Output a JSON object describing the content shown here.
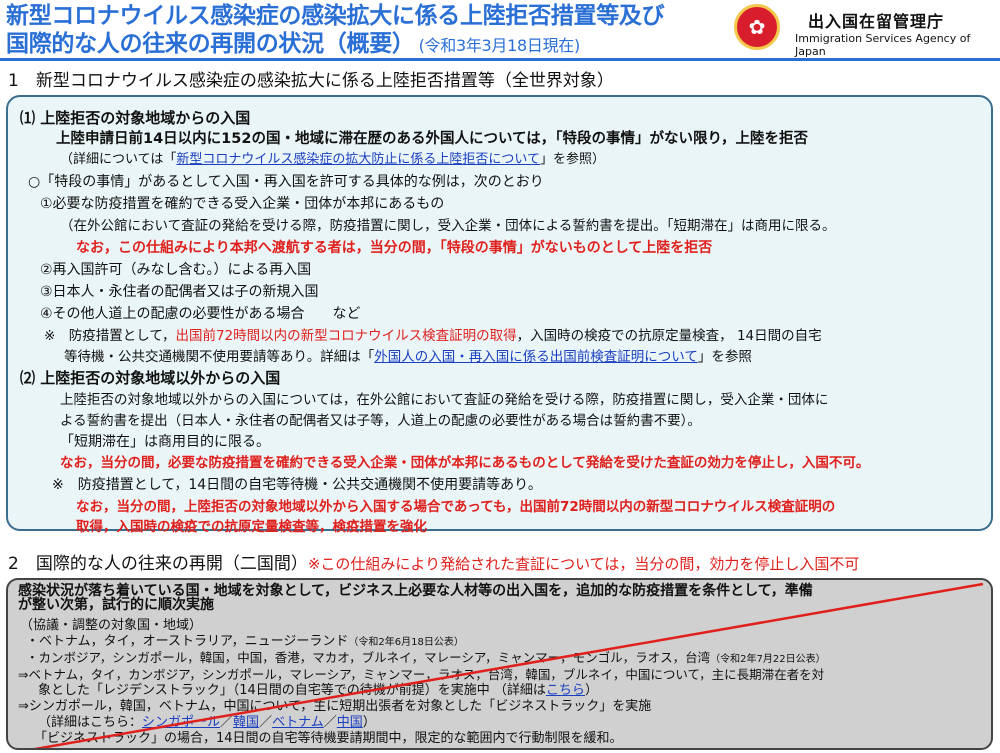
{
  "header": {
    "title_line1": "新型コロナウイルス感染症の感染拡大に係る上陸拒否措置等及び",
    "title_line2": "国際的な人の往来の再開の状況（概要）",
    "title_date": "(令和3年3月18日現在)",
    "agency_ja": "出入国在留管理庁",
    "agency_en": "Immigration Services Agency of Japan"
  },
  "section1": {
    "heading": "1　新型コロナウイルス感染症の感染拡大に係る上陸拒否措置等（全世界対象）",
    "s1_title": "⑴ 上陸拒否の対象地域からの入国",
    "s1_main": "上陸申請日前14日以内に152の国・地域に滞在歴のある外国人については，「特段の事情」がない限り，上陸を拒否",
    "s1_ref_pre": "（詳細については「",
    "s1_ref_link": "新型コロナウイルス感染症の拡大防止に係る上陸拒否について",
    "s1_ref_post": "」を参照）",
    "special_intro": "○「特段の事情」があるとして入国・再入国を許可する具体的な例は，次のとおり",
    "ex1": "①必要な防疫措置を確約できる受入企業・団体が本邦にあるもの",
    "ex1_detail": "（在外公館において査証の発給を受ける際，防疫措置に関し，受入企業・団体による誓約書を提出。「短期滞在」は商用に限る。",
    "ex1_red": "なお，この仕組みにより本邦へ渡航する者は，当分の間，「特段の事情」がないものとして上陸を拒否",
    "ex2": "②再入国許可（みなし含む。）による再入国",
    "ex3": "③日本人・永住者の配偶者又は子の新規入国",
    "ex4": "④その他人道上の配慮の必要性がある場合　　など",
    "note1_pre": "※　防疫措置として，",
    "note1_red": "出国前72時間以内の新型コロナウイルス検査証明の取得",
    "note1_post": "，入国時の検疫での抗原定量検査，  14日間の自宅",
    "note1_l2_pre": "等待機・公共交通機関不使用要請等あり。詳細は「",
    "note1_l2_link": "外国人の入国・再入国に係る出国前検査証明について",
    "note1_l2_post": "」を参照",
    "s2_title": "⑵ 上陸拒否の対象地域以外からの入国",
    "s2_l1": "上陸拒否の対象地域以外からの入国については，在外公館において査証の発給を受ける際，防疫措置に関し，受入企業・団体に",
    "s2_l2": "よる誓約書を提出（日本人・永住者の配偶者又は子等，人道上の配慮の必要性がある場合は誓約書不要）。",
    "s2_l3": "「短期滞在」は商用目的に限る。",
    "s2_red": "なお，当分の間，必要な防疫措置を確約できる受入企業・団体が本邦にあるものとして発給を受けた査証の効力を停止し，入国不可。",
    "s2_note": "※　防疫措置として，14日間の自宅等待機・公共交通機関不使用要請等あり。",
    "s2_red2_l1": "なお，当分の間，上陸拒否の対象地域以外から入国する場合であっても，出国前72時間以内の新型コロナウイルス検査証明の",
    "s2_red2_l2": "取得，入国時の検疫での抗原定量検査等，検疫措置を強化"
  },
  "section2": {
    "heading": "2　国際的な人の往来の再開（二国間）",
    "heading_note": "※この仕組みにより発給された査証については，当分の間，効力を停止し入国不可",
    "l1": "感染状況が落ち着いている国・地域を対象として，ビジネス上必要な人材等の出入国を，追加的な防疫措置を条件として，準備",
    "l2": "が整い次第，試行的に順次実施",
    "l3": "（協議・調整の対象国・地域）",
    "l4": "・ベトナム，タイ，オーストラリア，ニュージーランド",
    "l4_small": "（令和2年6月18日公表）",
    "l5": "・カンボジア，シンガポール，韓国，中国，香港，マカオ，ブルネイ，マレーシア，ミャンマー，モンゴル，ラオス，台湾",
    "l5_small": "（令和2年7月22日公表）",
    "l6": "⇒ベトナム，タイ，カンボジア，シンガポール，マレーシア，ミャンマー，ラオス，台湾，韓国，ブルネイ，中国について，主に長期滞在者を対",
    "l7_pre": "象とした「レジデンストラック」（14日間の自宅等での待機が前提）を実施中 （詳細は",
    "l7_link": "こちら",
    "l7_post": "）",
    "l8": "⇒シンガポール，韓国，ベトナム，中国について，主に短期出張者を対象とした「ビジネストラック」を実施",
    "l9_pre": "（詳細はこちら：",
    "link_sg": "シンガポール",
    "link_kr": "韓国",
    "link_vn": "ベトナム",
    "link_cn": "中国",
    "sep": "／",
    "l9_post": "）",
    "l10": "「ビジネストラック」の場合，14日間の自宅等待機要請期間中，限定的な範囲内で行動制限を緩和。"
  },
  "colors": {
    "title_blue": "#2a6fd6",
    "red": "#e0201c",
    "box1_bg": "#eaf5f8",
    "box2_bg": "#d0d0d0"
  },
  "icons": {
    "logo": "chrysanthemum-emblem-icon"
  }
}
